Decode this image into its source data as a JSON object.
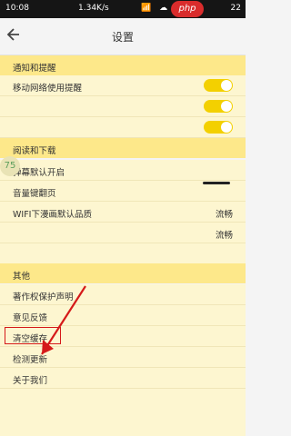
{
  "status": {
    "time": "10:08",
    "speed": "1.34K/s",
    "icons": "📶 ☁ ▮▮",
    "battery": "22",
    "watermark": "php"
  },
  "header": {
    "title": "设置"
  },
  "sections": [
    {
      "title": "通知和提醒"
    },
    {
      "title": "阅读和下载"
    },
    {
      "title": "其他"
    }
  ],
  "rows": {
    "mobile_network": "移动网络使用提醒",
    "danmaku_default": "弹幕默认开启",
    "volume_flip": "音量键翻页",
    "wifi_quality": "WIFI下漫画默认品质",
    "wifi_quality_value": "流畅",
    "quality_value_2": "流畅",
    "copyright": "著作权保护声明",
    "feedback": "意见反馈",
    "clear_cache": "清空缓存",
    "check_update": "检测更新",
    "about": "关于我们"
  },
  "toggles": {
    "color": "#f3d000"
  },
  "floating_badge": "75"
}
